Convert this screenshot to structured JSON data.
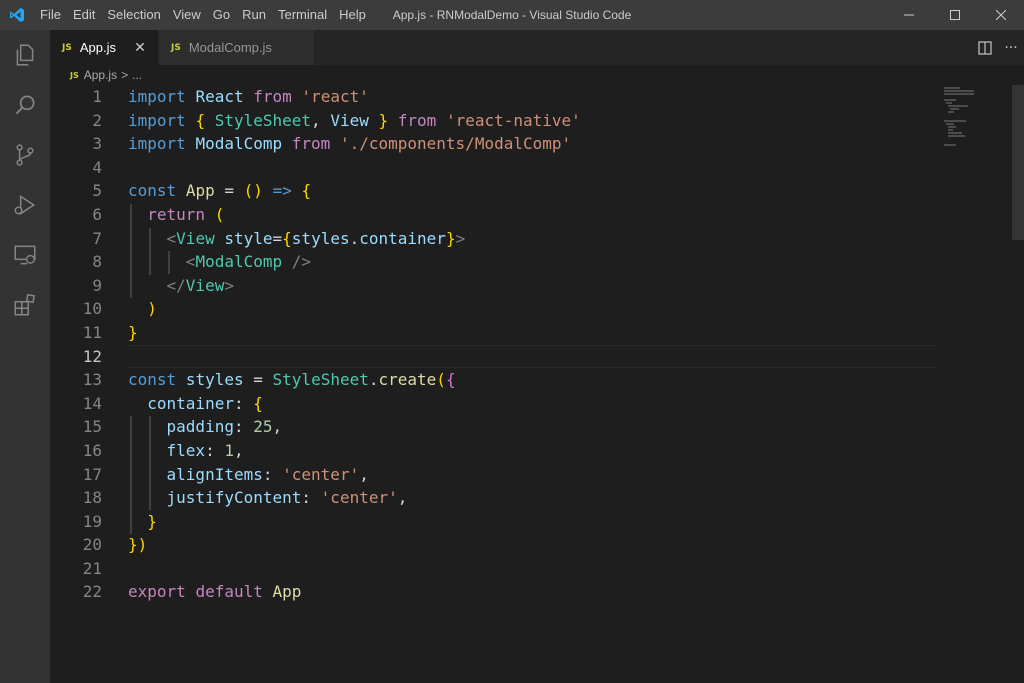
{
  "window": {
    "title": "App.js - RNModalDemo - Visual Studio Code",
    "menu": [
      "File",
      "Edit",
      "Selection",
      "View",
      "Go",
      "Run",
      "Terminal",
      "Help"
    ]
  },
  "activity_bar": {
    "items": [
      "explorer-icon",
      "search-icon",
      "source-control-icon",
      "run-debug-icon",
      "remote-explorer-icon",
      "extensions-icon"
    ]
  },
  "tabs": [
    {
      "icon_text": "JS",
      "label": "App.js",
      "active": true
    },
    {
      "icon_text": "JS",
      "label": "ModalComp.js",
      "active": false
    }
  ],
  "breadcrumb": {
    "icon_text": "JS",
    "file": "App.js",
    "separator": ">",
    "more": "..."
  },
  "editor": {
    "current_line": 12,
    "line_numbers": [
      "1",
      "2",
      "3",
      "4",
      "5",
      "6",
      "7",
      "8",
      "9",
      "10",
      "11",
      "12",
      "13",
      "14",
      "15",
      "16",
      "17",
      "18",
      "19",
      "20",
      "21",
      "22"
    ],
    "lines": [
      "import React from 'react'",
      "import { StyleSheet, View } from 'react-native'",
      "import ModalComp from './components/ModalComp'",
      "",
      "const App = () => {",
      "  return (",
      "    <View style={styles.container}>",
      "      <ModalComp />",
      "    </View>",
      "  )",
      "}",
      "",
      "const styles = StyleSheet.create({",
      "  container: {",
      "    padding: 25,",
      "    flex: 1,",
      "    alignItems: 'center',",
      "    justifyContent: 'center',",
      "  }",
      "})",
      "",
      "export default App"
    ]
  },
  "colors": {
    "keyword": "#569cd6",
    "control": "#c586c0",
    "string": "#ce9178",
    "variable": "#9cdcfe",
    "function": "#dcdcaa",
    "class": "#4ec9b0",
    "number": "#b5cea8"
  }
}
